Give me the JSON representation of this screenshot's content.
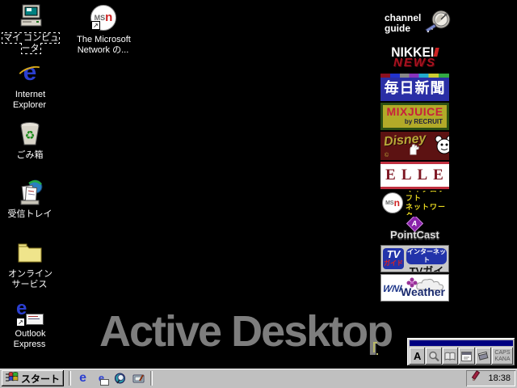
{
  "desktop": {
    "watermark": "Active Desktop",
    "icons": [
      {
        "id": "my-computer",
        "label": "マイ コンピュータ"
      },
      {
        "id": "msn",
        "label": "The Microsoft Network の..."
      },
      {
        "id": "internet-explorer",
        "label": "Internet Explorer"
      },
      {
        "id": "recycle-bin",
        "label": "ごみ箱"
      },
      {
        "id": "inbox",
        "label": "受信トレイ"
      },
      {
        "id": "online-services",
        "label": "オンライン サービス"
      },
      {
        "id": "outlook-express",
        "label": "Outlook Express"
      }
    ]
  },
  "msn_logo": {
    "ms": "MS",
    "n": "n"
  },
  "channel_bar": {
    "guide": {
      "line1": "channel",
      "line2": "guide",
      "icon": "satellite-dish-icon"
    },
    "nikkei": {
      "line1": "NIKKEI",
      "line2": "NEWS"
    },
    "mainichi": {
      "title": "毎日新聞"
    },
    "mixjuice": {
      "title": "MIXJUICE",
      "subtitle": "by RECRUIT"
    },
    "disney": {
      "title": "Disney",
      "copyright": "©"
    },
    "elle": {
      "title": "ELLE"
    },
    "msn": {
      "line1": "マイクロソフト",
      "line2": "ネットワーク"
    },
    "pointcast": {
      "icon_letter": "A",
      "title": "PointCast"
    },
    "tvguide": {
      "tv": "TV",
      "guide": "ガイド",
      "internet": "インターネット",
      "title": "TVガイド"
    },
    "weather": {
      "wni": "WNI",
      "title": "Weather"
    }
  },
  "ime_toolbar": {
    "input_mode": "A",
    "caps": "CAPS",
    "kana": "KANA",
    "icons": [
      "input-mode",
      "magnifier-icon",
      "open-book-icon",
      "properties-icon",
      "closed-book-icon"
    ]
  },
  "taskbar": {
    "start_label": "スタート",
    "quick_launch": [
      "internet-explorer-icon",
      "outlook-express-icon",
      "view-channels-icon",
      "show-desktop-icon"
    ],
    "tray_icon": "ime-pen-icon",
    "clock": "18:38"
  }
}
